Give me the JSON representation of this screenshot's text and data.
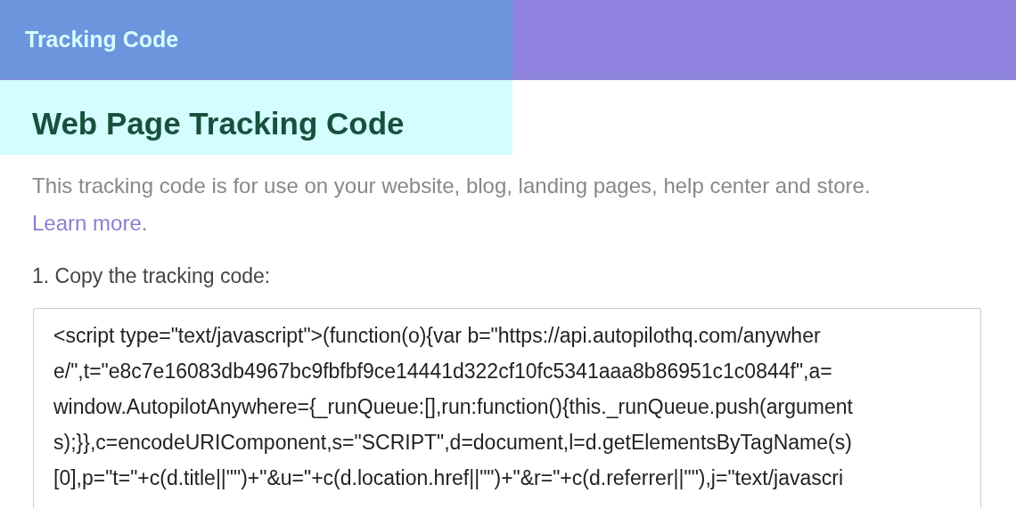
{
  "header": {
    "title": "Tracking Code"
  },
  "page": {
    "heading": "Web Page Tracking Code",
    "intro": "This tracking code is for use on your website, blog, landing pages, help center and store.",
    "link": "Learn more",
    "after_link": ".",
    "step": "1. Copy the tracking code:"
  },
  "code_lines": [
    "<script type=\"text/javascript\">(function(o){var b=\"https://api.autopilothq.com/anywher",
    "e/\",t=\"e8c7e16083db4967bc9fbfbf9ce14441d322cf10fc5341aaa8b86951c1c0844f\",a=",
    "window.AutopilotAnywhere={_runQueue:[],run:function(){this._runQueue.push(argument",
    "s);}},c=encodeURIComponent,s=\"SCRIPT\",d=document,l=d.getElementsByTagName(s)",
    "[0],p=\"t=\"+c(d.title||\"\")+\"&u=\"+c(d.location.href||\"\")+\"&r=\"+c(d.referrer||\"\"),j=\"text/javascri"
  ]
}
